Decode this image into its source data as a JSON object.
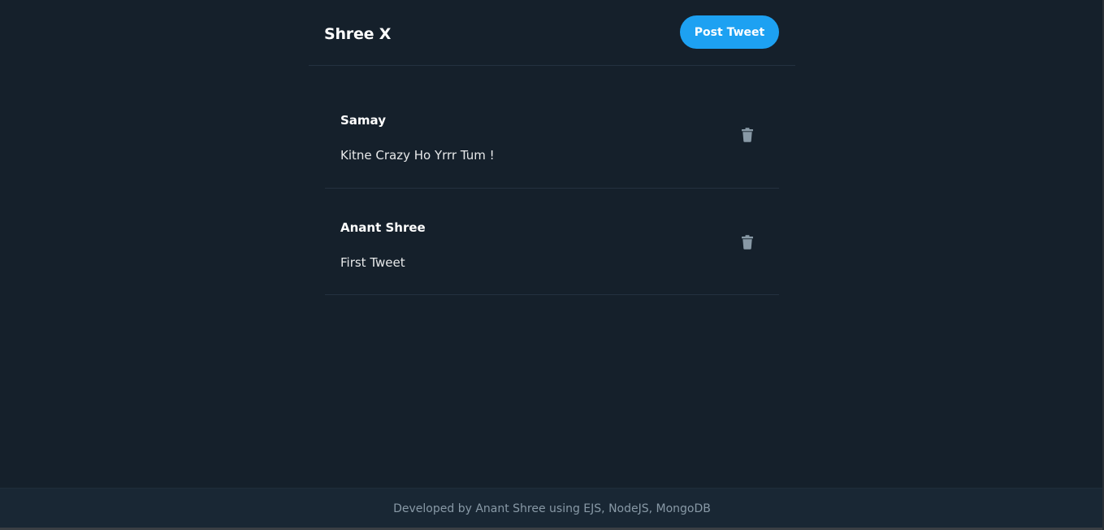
{
  "header": {
    "brand": "Shree X",
    "post_button_label": "Post Tweet"
  },
  "tweets": [
    {
      "user": "Samay",
      "text": "Kitne Crazy Ho Yrrr Tum !",
      "delete_icon": "trash-icon"
    },
    {
      "user": "Anant Shree",
      "text": "First Tweet",
      "delete_icon": "trash-icon"
    }
  ],
  "footer": {
    "text": "Developed by Anant Shree using EJS, NodeJS, MongoDB"
  },
  "colors": {
    "background": "#15202b",
    "accent": "#1da1f2",
    "footer_background": "#192734",
    "muted_text": "#8899a6"
  }
}
